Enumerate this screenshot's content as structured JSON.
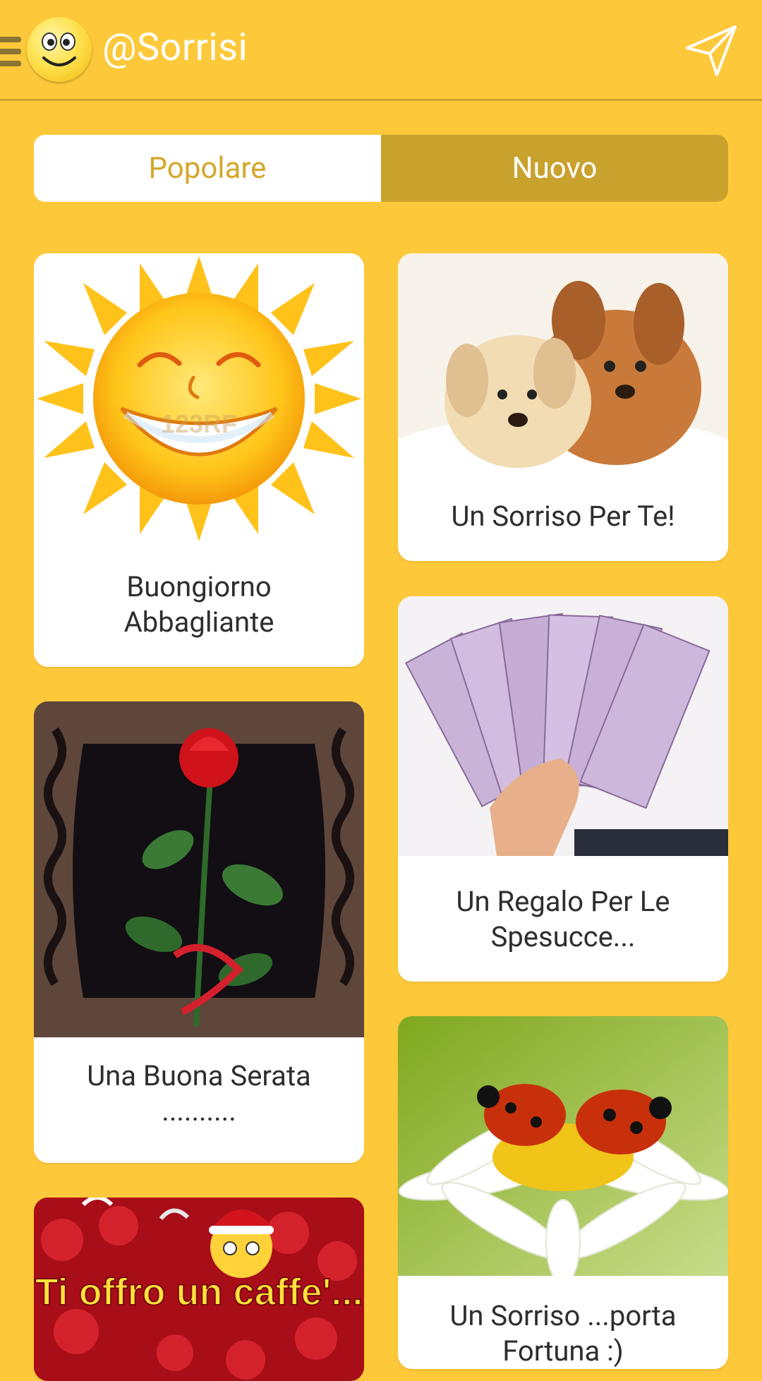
{
  "header": {
    "title": "@Sorrisi",
    "menu_icon": "hamburger-menu-icon",
    "avatar_icon": "smiley-face-icon",
    "send_icon": "paper-plane-icon"
  },
  "tabs": [
    {
      "label": "Popolare",
      "selected": false
    },
    {
      "label": "Nuovo",
      "selected": true
    }
  ],
  "cards": [
    {
      "title": "Buongiorno Abbagliante",
      "image": "smiling-sun"
    },
    {
      "title": "Un Sorriso Per Te!",
      "image": "two-puppies"
    },
    {
      "title": "Una Buona Serata ..........",
      "image": "red-rose-frame"
    },
    {
      "title": "Un Regalo Per Le Spesucce...",
      "image": "hand-with-500-euro-banknotes"
    },
    {
      "title": "Un Sorriso ...porta Fortuna :)",
      "image": "ladybugs-on-daisy"
    },
    {
      "title": "",
      "image": "christmas-roses-coffee",
      "image_text": "Ti offro un caffe'..."
    }
  ],
  "image_overlays": {
    "watermark": "123RF"
  },
  "colors": {
    "background": "#FDC93A",
    "tab_selected": "#C9A22E",
    "tab_unselected_text": "#D4A72C",
    "card": "#FFFFFF",
    "text": "#2E2E2E"
  }
}
